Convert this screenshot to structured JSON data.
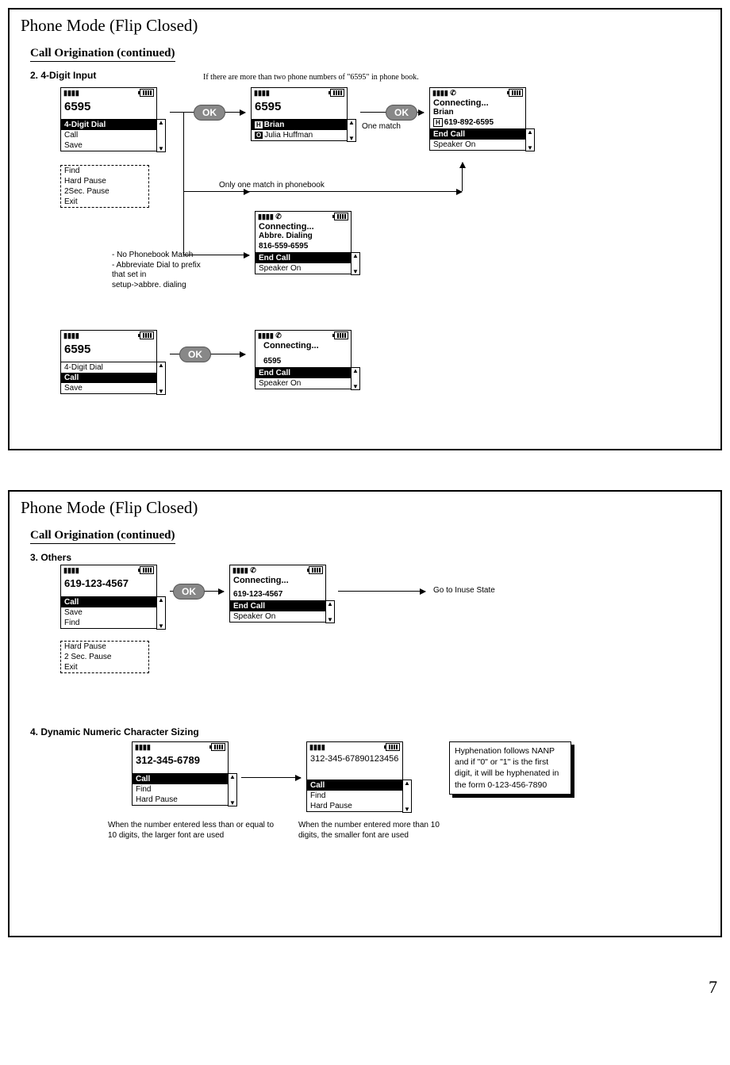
{
  "page_number": "7",
  "frame1": {
    "title": "Phone Mode (Flip Closed)",
    "section": "Call Origination (continued)",
    "sub1": "2. 4-Digit Input",
    "note_top": "If there are more than two phone numbers of \"6595\" in phone book.",
    "note_one_match": "One match",
    "note_only_one": "Only one match in phonebook",
    "note_no_match": "- No Phonebook Match\n- Abbreviate Dial to prefix\n  that set in\n  setup->abbre. dialing",
    "ok": "OK",
    "screens": {
      "s1": {
        "num": "6595",
        "menu": [
          "4-Digit Dial",
          "Call",
          "Save"
        ],
        "sel": 0,
        "ext": [
          "Find",
          "Hard Pause",
          "2Sec. Pause",
          "Exit"
        ]
      },
      "s2": {
        "num": "6595",
        "rows": [
          {
            "tag": "H",
            "text": "Brian",
            "sel": true
          },
          {
            "tag": "O",
            "text": "Julia Huffman",
            "sel": false
          }
        ]
      },
      "s3": {
        "conn": "Connecting...",
        "name": "Brian",
        "hnum": "619-892-6595",
        "menu": [
          "End Call",
          "Speaker On"
        ],
        "sel": 0
      },
      "s4": {
        "conn": "Connecting...",
        "name": "Abbre. Dialing",
        "num": "816-559-6595",
        "menu": [
          "End Call",
          "Speaker On"
        ],
        "sel": 0
      },
      "s5": {
        "num": "6595",
        "menu": [
          "4-Digit Dial",
          "Call",
          "Save"
        ],
        "sel": 1
      },
      "s6": {
        "conn": "Connecting...",
        "num": "6595",
        "menu": [
          "End Call",
          "Speaker On"
        ],
        "sel": 0
      }
    }
  },
  "frame2": {
    "title": "Phone Mode (Flip Closed)",
    "section": "Call Origination (continued)",
    "sub3": "3. Others",
    "sub4": "4. Dynamic Numeric Character Sizing",
    "goto": "Go to Inuse State",
    "ok": "OK",
    "info": "Hyphenation follows NANP and if \"0\" or \"1\" is the first digit, it will be hyphenated in the form 0-123-456-7890",
    "cap1": "When the number entered less than or equal to 10 digits,  the larger font are used",
    "cap2": "When the number entered more than 10 digits, the smaller font are used",
    "screens": {
      "o1": {
        "num": "619-123-4567",
        "menu": [
          "Call",
          "Save",
          "Find"
        ],
        "sel": 0,
        "ext": [
          "Hard Pause",
          "2 Sec. Pause",
          "Exit"
        ]
      },
      "o2": {
        "conn": "Connecting...",
        "num": "619-123-4567",
        "menu": [
          "End Call",
          "Speaker On"
        ],
        "sel": 0
      },
      "d1": {
        "num": "312-345-6789",
        "menu": [
          "Call",
          "Find",
          "Hard Pause"
        ],
        "sel": 0
      },
      "d2": {
        "num": "312-345-67890123456",
        "menu": [
          "Call",
          "Find",
          "Hard Pause"
        ],
        "sel": 0
      }
    }
  }
}
